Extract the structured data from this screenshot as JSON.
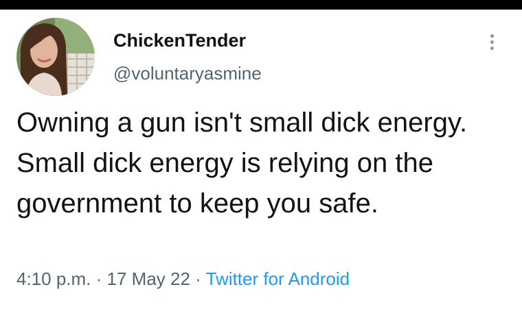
{
  "tweet": {
    "display_name": "ChickenTender",
    "handle": "@voluntaryasmine",
    "text": "Owning a gun isn't small dick energy. Small dick energy is relying on the government to keep you safe.",
    "time": "4:10 p.m.",
    "separator": " · ",
    "date": "17 May 22",
    "source": "Twitter for Android"
  },
  "icons": {
    "more": "more-vertical-icon",
    "avatar": "profile-photo"
  },
  "colors": {
    "text_primary": "#0f1419",
    "text_secondary": "#536471",
    "link": "#1d9bf0",
    "top_bar": "#000000"
  }
}
